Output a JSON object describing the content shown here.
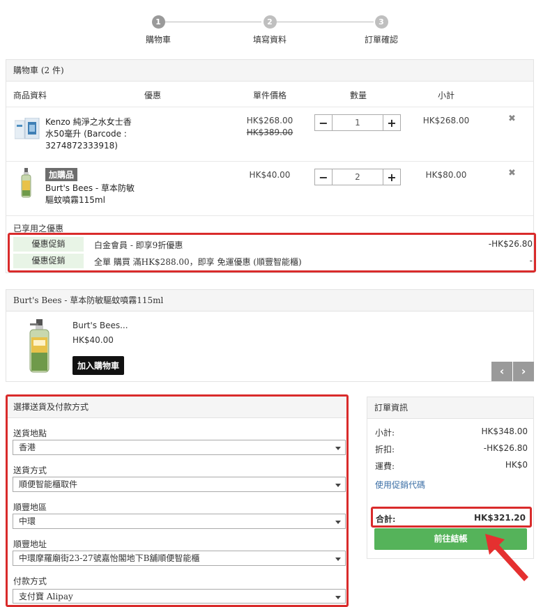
{
  "steps": [
    {
      "num": "1",
      "label": "購物車"
    },
    {
      "num": "2",
      "label": "填寫資料"
    },
    {
      "num": "3",
      "label": "訂單確認"
    }
  ],
  "cart": {
    "title": "購物車 (2 件)",
    "columns": {
      "product": "商品資料",
      "discount": "優惠",
      "unit_price": "單件價格",
      "qty": "數量",
      "subtotal": "小計"
    },
    "items": [
      {
        "name_l1": "Kenzo 純淨之水女士香",
        "name_l2": "水50毫升 (Barcode :",
        "name_l3": "3274872333918)",
        "price": "HK$268.00",
        "orig_price": "HK$389.00",
        "qty": "1",
        "subtotal": "HK$268.00",
        "remove": "✖"
      },
      {
        "badge": "加購品",
        "name_l1": "Burt's Bees - 草本防敏",
        "name_l2": "驅蚊噴霧115ml",
        "price": "HK$40.00",
        "qty": "2",
        "subtotal": "HK$80.00",
        "remove": "✖"
      }
    ],
    "qty_minus": "−",
    "qty_plus": "+",
    "applied_title": "已享用之優惠",
    "promos": [
      {
        "tag": "優惠促銷",
        "desc": "白金會員 - 即享9折優惠",
        "amount": "-HK$26.80"
      },
      {
        "tag": "優惠促銷",
        "desc": "全單 購買 滿HK$288.00，即享 免運優惠 (順豐智能櫃)",
        "amount": "-"
      }
    ]
  },
  "addon": {
    "title": "Burt's Bees - 草本防敏驅蚊噴霧115ml",
    "product_name": "Burt's Bees...",
    "product_price": "HK$40.00",
    "add_button": "加入購物車",
    "prev": "‹",
    "next": "›"
  },
  "shipping": {
    "title": "選擇送貨及付款方式",
    "fields": [
      {
        "label": "送貨地點",
        "value": "香港"
      },
      {
        "label": "送貨方式",
        "value": "順便智能櫃取件"
      },
      {
        "label": "順豐地區",
        "value": "中環"
      },
      {
        "label": "順豐地址",
        "value": "中環摩羅廟街23-27號嘉怡閣地下B舖順便智能櫃"
      },
      {
        "label": "付款方式",
        "value": "支付寶 Alipay"
      }
    ]
  },
  "order": {
    "title": "訂單資訊",
    "subtotal_label": "小計:",
    "subtotal": "HK$348.00",
    "discount_label": "折扣:",
    "discount": "-HK$26.80",
    "shipping_label": "運費:",
    "shipping": "HK$0",
    "promo_link": "使用促銷代碼",
    "total_label": "合計:",
    "total": "HK$321.20",
    "checkout": "前往結帳"
  },
  "colors": {
    "highlight": "#d92b2b",
    "checkout": "#55b35a",
    "promo_tag_bg": "#e8f4e6",
    "link": "#3a6ea5"
  }
}
